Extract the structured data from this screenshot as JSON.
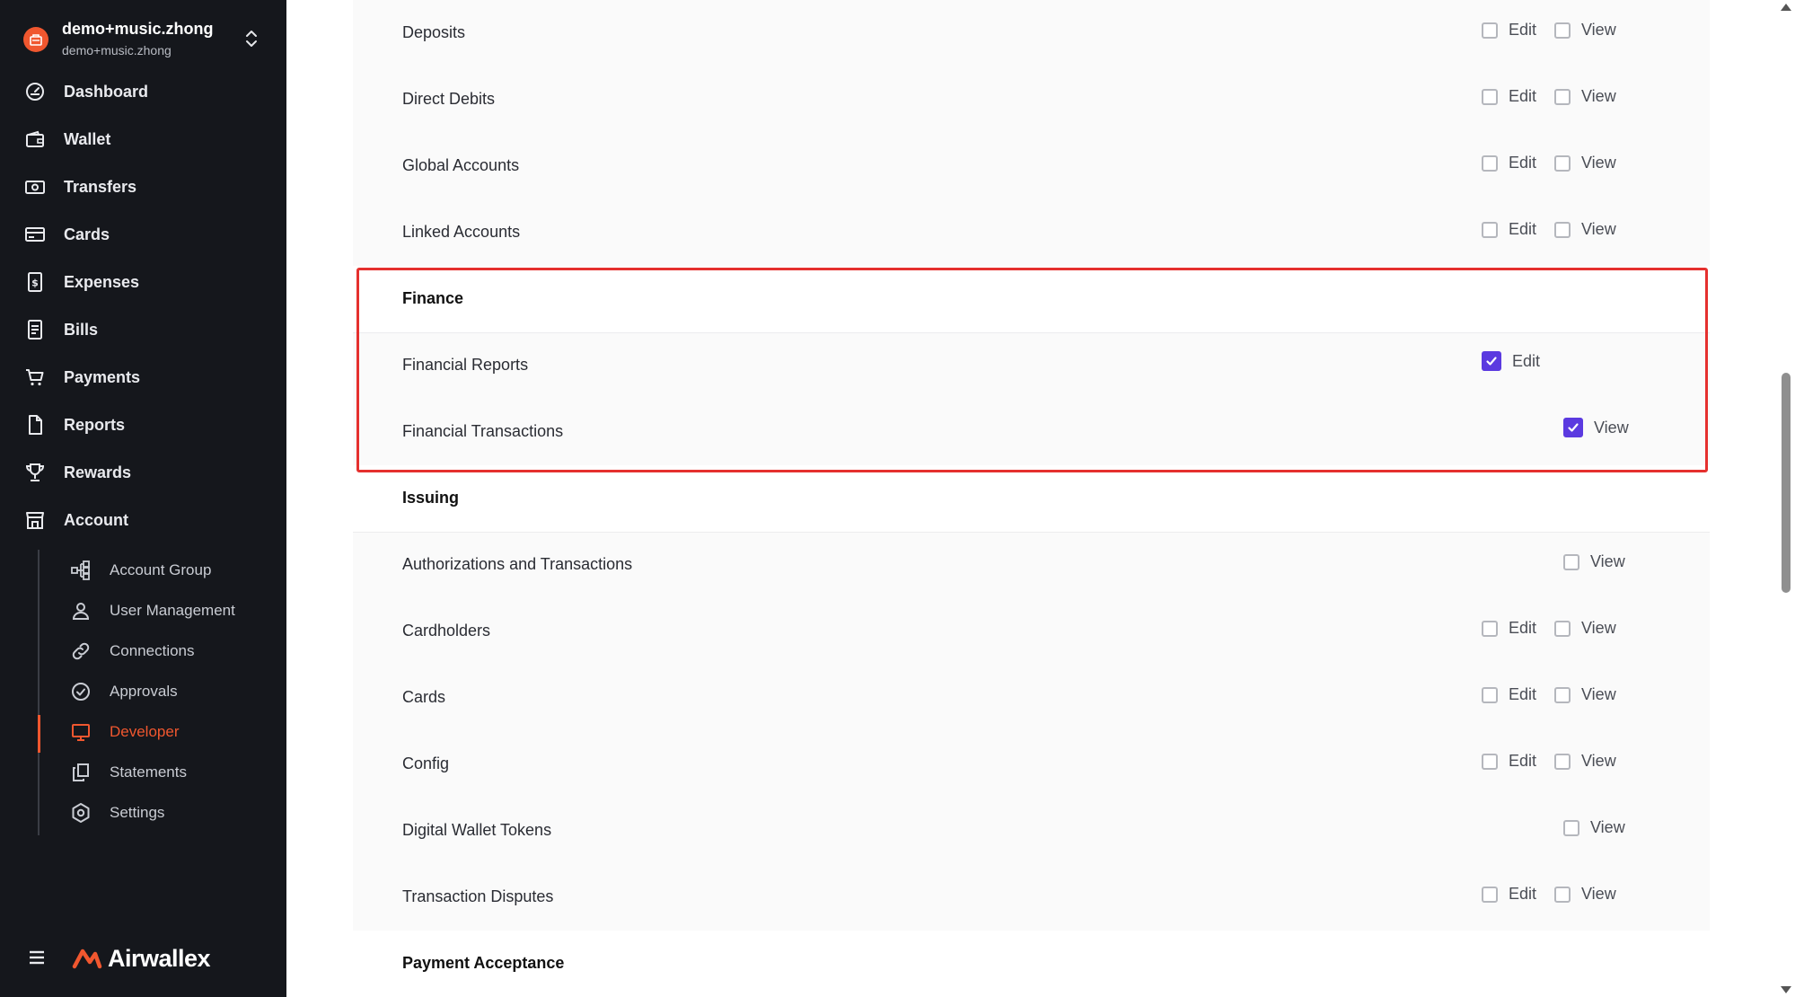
{
  "account": {
    "name": "demo+music.zhong",
    "sub": "demo+music.zhong"
  },
  "nav": [
    {
      "label": "Dashboard",
      "icon": "dashboard-icon"
    },
    {
      "label": "Wallet",
      "icon": "wallet-icon"
    },
    {
      "label": "Transfers",
      "icon": "transfers-icon"
    },
    {
      "label": "Cards",
      "icon": "cards-icon"
    },
    {
      "label": "Expenses",
      "icon": "expenses-icon"
    },
    {
      "label": "Bills",
      "icon": "bills-icon"
    },
    {
      "label": "Payments",
      "icon": "cart-icon"
    },
    {
      "label": "Reports",
      "icon": "reports-icon"
    },
    {
      "label": "Rewards",
      "icon": "trophy-icon"
    },
    {
      "label": "Account",
      "icon": "store-icon"
    }
  ],
  "account_sub": [
    {
      "label": "Account Group",
      "icon": "account-group-icon"
    },
    {
      "label": "User Management",
      "icon": "user-icon"
    },
    {
      "label": "Connections",
      "icon": "link-icon"
    },
    {
      "label": "Approvals",
      "icon": "check-circle-icon"
    },
    {
      "label": "Developer",
      "icon": "monitor-icon",
      "active": true
    },
    {
      "label": "Statements",
      "icon": "statements-icon"
    },
    {
      "label": "Settings",
      "icon": "gear-icon"
    }
  ],
  "brand": "Airwallex",
  "colors": {
    "accent": "#f0572f",
    "checkbox_checked": "#5b3ae0",
    "highlight": "#e5302e"
  },
  "permission_labels": {
    "edit": "Edit",
    "view": "View"
  },
  "rows": {
    "deposits": {
      "label": "Deposits",
      "edit": false,
      "view": false
    },
    "direct_debits": {
      "label": "Direct Debits",
      "edit": false,
      "view": false
    },
    "global_accounts": {
      "label": "Global Accounts",
      "edit": false,
      "view": false
    },
    "linked_accounts": {
      "label": "Linked Accounts",
      "edit": false,
      "view": false
    },
    "finance_section": {
      "label": "Finance"
    },
    "financial_reports": {
      "label": "Financial Reports",
      "edit": true
    },
    "financial_transactions": {
      "label": "Financial Transactions",
      "view": true
    },
    "issuing_section": {
      "label": "Issuing"
    },
    "authorizations": {
      "label": "Authorizations and Transactions",
      "view": false
    },
    "cardholders": {
      "label": "Cardholders",
      "edit": false,
      "view": false
    },
    "cards": {
      "label": "Cards",
      "edit": false,
      "view": false
    },
    "config": {
      "label": "Config",
      "edit": false,
      "view": false
    },
    "digital_wallet_tokens": {
      "label": "Digital Wallet Tokens",
      "view": false
    },
    "transaction_disputes": {
      "label": "Transaction Disputes",
      "edit": false,
      "view": false
    },
    "payment_acceptance_section": {
      "label": "Payment Acceptance"
    }
  }
}
